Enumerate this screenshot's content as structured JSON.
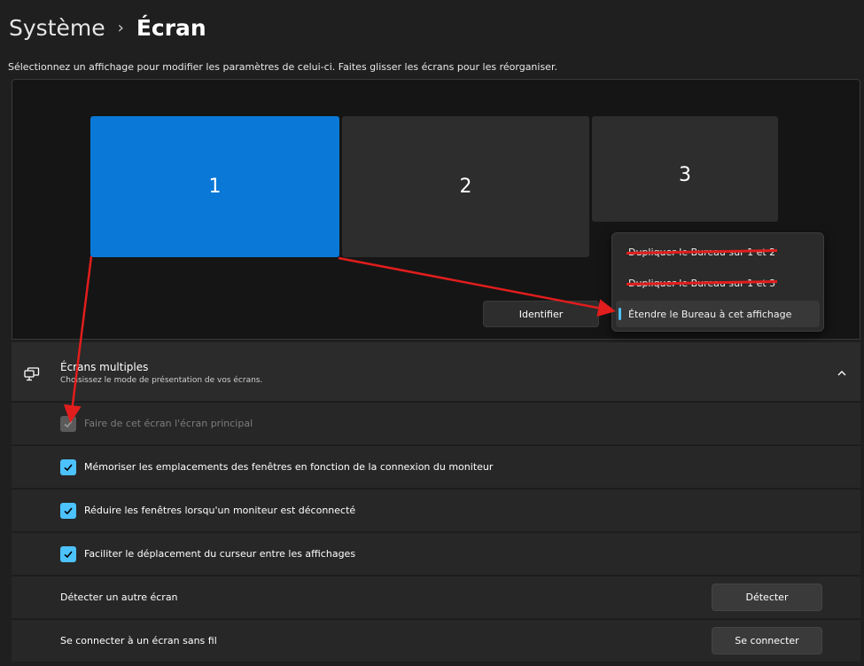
{
  "header": {
    "parent": "Système",
    "separator": "›",
    "current": "Écran"
  },
  "instruction": "Sélectionnez un affichage pour modifier les paramètres de celui-ci. Faites glisser les écrans pour les réorganiser.",
  "monitors": [
    {
      "label": "1",
      "selected": true,
      "color": "#0a78d7"
    },
    {
      "label": "2",
      "selected": false
    },
    {
      "label": "3",
      "selected": false
    }
  ],
  "identify_label": "Identifier",
  "display_mode_menu": {
    "items": [
      {
        "label": "Dupliquer le Bureau sur 1 et 2",
        "struck": true
      },
      {
        "label": "Dupliquer le Bureau sur 1 et 3",
        "struck": true
      },
      {
        "label": "Étendre le Bureau à cet affichage",
        "selected": true
      }
    ]
  },
  "multiple_displays": {
    "icon": "monitor-icon",
    "title": "Écrans multiples",
    "subtitle": "Choisissez le mode de présentation de vos écrans.",
    "expanded": true
  },
  "options": [
    {
      "label": "Faire de cet écran l'écran principal",
      "checked": true,
      "disabled": true
    },
    {
      "label": "Mémoriser les emplacements des fenêtres en fonction de la connexion du moniteur",
      "checked": true
    },
    {
      "label": "Réduire les fenêtres lorsqu'un moniteur est déconnecté",
      "checked": true
    },
    {
      "label": "Faciliter le déplacement du curseur entre les affichages",
      "checked": true
    }
  ],
  "detect": {
    "label": "Détecter un autre écran",
    "button": "Détecter"
  },
  "wireless": {
    "label": "Se connecter à un écran sans fil",
    "button": "Se connecter"
  },
  "colors": {
    "accent": "#4cc2ff",
    "selected_monitor": "#0a78d7",
    "annotation": "#e11d1d"
  }
}
